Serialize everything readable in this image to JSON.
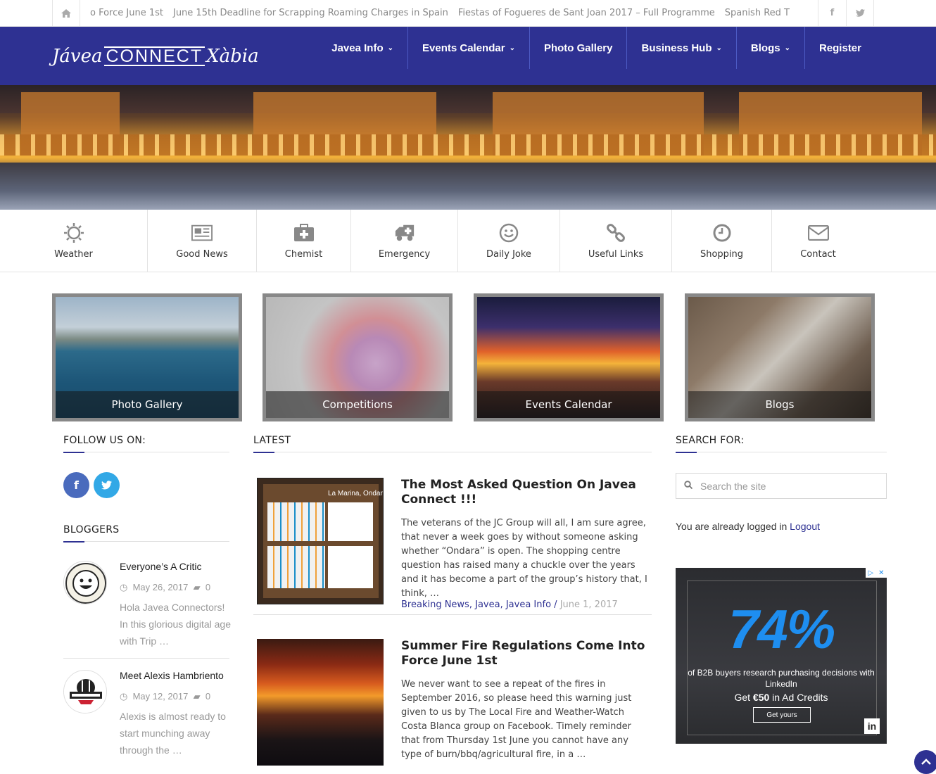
{
  "ticker": {
    "items": [
      "o Force June 1st",
      "June 15th Deadline for Scrapping Roaming Charges in Spain",
      "Fiestas of Fogueres de Sant Joan 2017 – Full Programme",
      "Spanish Red T"
    ]
  },
  "topbar_social": {
    "facebook": "f",
    "twitter": "t"
  },
  "logo": {
    "part1": "Jávea",
    "part2": "CONNECT",
    "part3": "Xàbia"
  },
  "nav": {
    "items": [
      {
        "label": "Javea Info",
        "dropdown": "⌄"
      },
      {
        "label": "Events Calendar",
        "dropdown": "⌄"
      },
      {
        "label": "Photo Gallery",
        "dropdown": ""
      },
      {
        "label": "Business Hub",
        "dropdown": "⌄"
      },
      {
        "label": "Blogs",
        "dropdown": "⌄"
      },
      {
        "label": "Register",
        "dropdown": ""
      }
    ]
  },
  "iconbar": {
    "items": [
      {
        "label": "Weather",
        "icon": "sun-icon"
      },
      {
        "label": "Good News",
        "icon": "newspaper-icon"
      },
      {
        "label": "Chemist",
        "icon": "medkit-icon"
      },
      {
        "label": "Emergency",
        "icon": "ambulance-icon"
      },
      {
        "label": "Daily Joke",
        "icon": "smile-icon"
      },
      {
        "label": "Useful Links",
        "icon": "link-icon"
      },
      {
        "label": "Shopping",
        "icon": "clock-icon"
      },
      {
        "label": "Contact",
        "icon": "envelope-icon"
      }
    ]
  },
  "tiles": [
    {
      "label": "Photo Gallery"
    },
    {
      "label": "Competitions"
    },
    {
      "label": "Events Calendar"
    },
    {
      "label": "Blogs"
    }
  ],
  "follow": {
    "title": "FOLLOW US ON:"
  },
  "bloggers": {
    "title": "BLOGGERS",
    "items": [
      {
        "title": "Everyone’s A Critic",
        "date": "May 26, 2017",
        "comments": "0",
        "excerpt": "Hola Javea Connectors! In this glorious digital age with Trip …"
      },
      {
        "title": "Meet Alexis Hambriento",
        "date": "May 12, 2017",
        "comments": "0",
        "excerpt": "Alexis is almost ready to start munching away through the …"
      }
    ]
  },
  "latest": {
    "title": "LATEST",
    "posts": [
      {
        "title": "The Most Asked Question On Javea Connect !!!",
        "excerpt": "The veterans of the JC Group will all, I am sure agree, that never a week goes by without someone asking whether “Ondara” is open. The shopping centre question has raised many a chuckle over the years and it has become a part of the group’s history that, I think, …",
        "cat1": "Breaking News",
        "cat2": "Javea",
        "cat3": "Javea Info",
        "date": "June 1, 2017",
        "thumb_caption": "La Marina, Ondara"
      },
      {
        "title": "Summer Fire Regulations Come Into Force June 1st",
        "excerpt": "We never want to see a repeat of the fires in September 2016, so please heed this warning just given to us by The Local Fire and Weather-Watch Costa Blanca group on Facebook. Timely reminder that from Thursday 1st June you cannot have any type of burn/bbq/agricultural fire, in a …"
      }
    ]
  },
  "search": {
    "title": "SEARCH FOR:",
    "placeholder": "Search the site"
  },
  "login": {
    "text": "You are already logged in",
    "link": "Logout"
  },
  "ad": {
    "headline": "74%",
    "line1": "of B2B buyers research purchasing decisions with LinkedIn",
    "line2_pre": "Get ",
    "line2_bold": "€50",
    "line2_post": " in Ad Credits",
    "button": "Get yours",
    "brand": "in"
  },
  "colors": {
    "brand": "#2e3192",
    "facebook": "#4a6bbd",
    "twitter": "#32a8e6"
  }
}
